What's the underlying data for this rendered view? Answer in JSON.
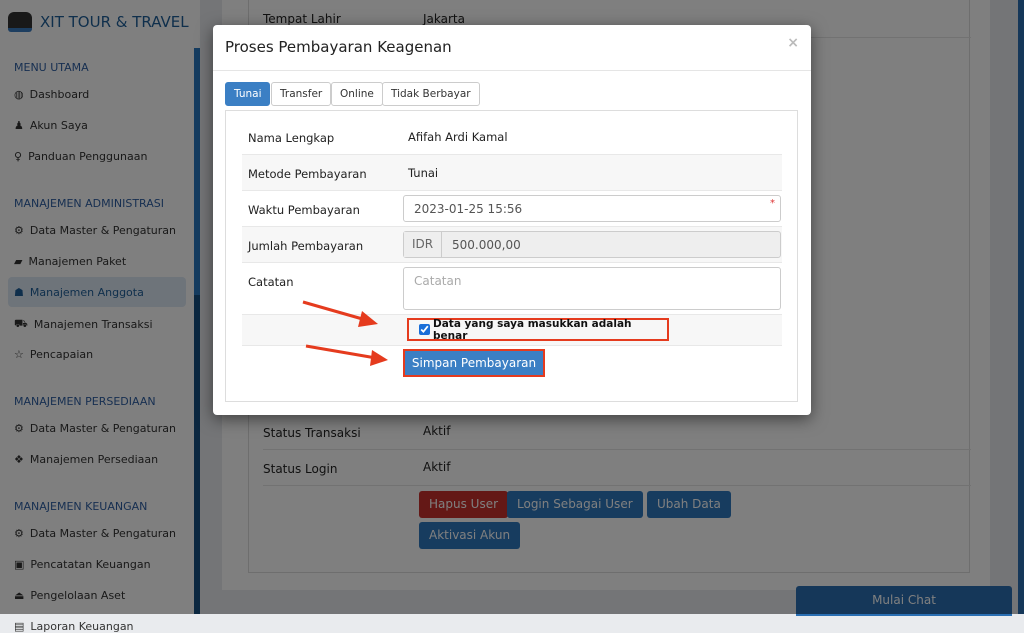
{
  "sidebar": {
    "brand": "XIT TOUR & TRAVEL",
    "sections": [
      {
        "title": "MENU UTAMA",
        "items": [
          {
            "label": "Dashboard",
            "icon": "globe-icon"
          },
          {
            "label": "Akun Saya",
            "icon": "user-icon"
          },
          {
            "label": "Panduan Penggunaan",
            "icon": "lightbulb-icon"
          }
        ]
      },
      {
        "title": "MANAJEMEN ADMINISTRASI",
        "items": [
          {
            "label": "Data Master & Pengaturan",
            "icon": "cogs-icon"
          },
          {
            "label": "Manajemen Paket",
            "icon": "book-icon"
          },
          {
            "label": "Manajemen Anggota",
            "icon": "users-icon",
            "active": true
          },
          {
            "label": "Manajemen Transaksi",
            "icon": "cart-icon"
          },
          {
            "label": "Pencapaian",
            "icon": "star-icon"
          }
        ]
      },
      {
        "title": "MANAJEMEN PERSEDIAAN",
        "items": [
          {
            "label": "Data Master & Pengaturan",
            "icon": "cogs-icon"
          },
          {
            "label": "Manajemen Persediaan",
            "icon": "cubes-icon"
          }
        ]
      },
      {
        "title": "MANAJEMEN KEUANGAN",
        "items": [
          {
            "label": "Data Master & Pengaturan",
            "icon": "cogs-icon"
          },
          {
            "label": "Pencatatan Keuangan",
            "icon": "money-icon"
          },
          {
            "label": "Pengelolaan Aset",
            "icon": "hdd-icon"
          },
          {
            "label": "Laporan Keuangan",
            "icon": "report-icon"
          }
        ]
      }
    ]
  },
  "background": {
    "rows": [
      {
        "label": "Tempat Lahir",
        "value": "Jakarta"
      },
      {
        "label": "Status Transaksi",
        "value": "Aktif"
      },
      {
        "label": "Status Login",
        "value": "Aktif"
      }
    ],
    "buttons": {
      "delete": "Hapus User",
      "login_as": "Login Sebagai User",
      "edit": "Ubah Data",
      "activate": "Aktivasi Akun"
    },
    "chat": "Mulai Chat"
  },
  "modal": {
    "title": "Proses Pembayaran Keagenan",
    "close": "×",
    "tabs": [
      {
        "label": "Tunai",
        "active": true
      },
      {
        "label": "Transfer"
      },
      {
        "label": "Online"
      },
      {
        "label": "Tidak Berbayar"
      }
    ],
    "fields": {
      "name_label": "Nama Lengkap",
      "name_value": "Afifah Ardi Kamal",
      "method_label": "Metode Pembayaran",
      "method_value": "Tunai",
      "time_label": "Waktu Pembayaran",
      "time_value": "2023-01-25 15:56",
      "required": "*",
      "amount_label": "Jumlah Pembayaran",
      "currency": "IDR",
      "amount_value": "500.000,00",
      "note_label": "Catatan",
      "note_placeholder": "Catatan"
    },
    "confirm_label": "Data yang saya masukkan adalah benar",
    "confirm_checked": true,
    "save_label": "Simpan Pembayaran"
  },
  "colors": {
    "primary": "#3b7fc4",
    "danger": "#c9302c",
    "highlight": "#e53b1e"
  }
}
